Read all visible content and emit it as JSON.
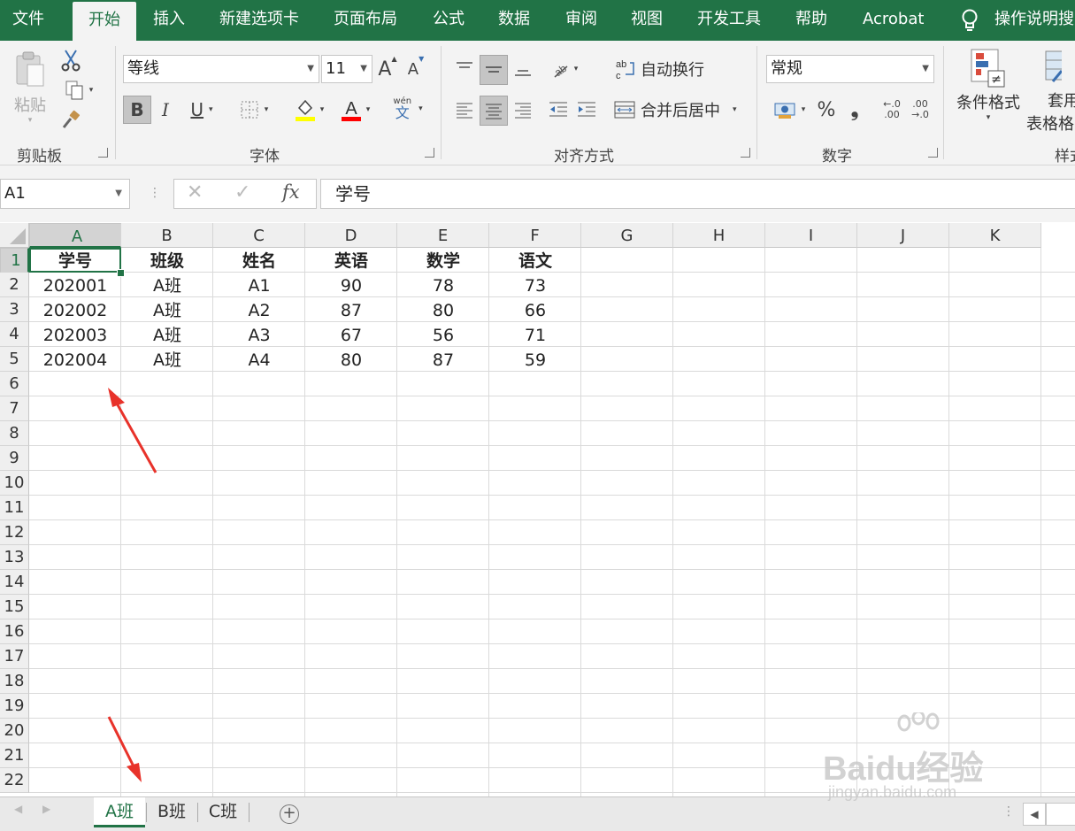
{
  "ribbon_tabs": [
    "文件",
    "开始",
    "插入",
    "新建选项卡",
    "页面布局",
    "公式",
    "数据",
    "审阅",
    "视图",
    "开发工具",
    "帮助",
    "Acrobat"
  ],
  "active_tab": "开始",
  "tell_me": "操作说明搜",
  "clipboard": {
    "paste_label": "粘贴",
    "group_label": "剪贴板"
  },
  "font": {
    "name": "等线",
    "size": "11",
    "grow": "A",
    "shrink": "A",
    "bold": "B",
    "italic": "I",
    "underline": "U",
    "phonetic_top": "wén",
    "phonetic_bottom": "文",
    "group_label": "字体",
    "fill_color": "#ffff00",
    "font_color": "#ff0000"
  },
  "alignment": {
    "wrap_label": "自动换行",
    "merge_label": "合并后居中",
    "group_label": "对齐方式"
  },
  "number": {
    "format": "常规",
    "percent": "%",
    "comma": "❟",
    "dec_inc_top": "←.0",
    "dec_inc_bottom": ".00",
    "dec_dec_top": ".00",
    "dec_dec_bottom": "→.0",
    "group_label": "数字"
  },
  "styles": {
    "cond_format": "条件格式",
    "table_format_1": "套用",
    "table_format_2": "表格格",
    "group_label": "样式"
  },
  "formula_bar": {
    "name_box": "A1",
    "fx": "fx",
    "content": "学号"
  },
  "columns": [
    "A",
    "B",
    "C",
    "D",
    "E",
    "F",
    "G",
    "H",
    "I",
    "J",
    "K"
  ],
  "rows": [
    "1",
    "2",
    "3",
    "4",
    "5",
    "6",
    "7",
    "8",
    "9",
    "10",
    "11",
    "12",
    "13",
    "14",
    "15",
    "16",
    "17",
    "18",
    "19",
    "20",
    "21",
    "22"
  ],
  "table": {
    "header": [
      "学号",
      "班级",
      "姓名",
      "英语",
      "数学",
      "语文"
    ],
    "rows": [
      [
        "202001",
        "A班",
        "A1",
        "90",
        "78",
        "73"
      ],
      [
        "202002",
        "A班",
        "A2",
        "87",
        "80",
        "66"
      ],
      [
        "202003",
        "A班",
        "A3",
        "67",
        "56",
        "71"
      ],
      [
        "202004",
        "A班",
        "A4",
        "80",
        "87",
        "59"
      ]
    ]
  },
  "sheets": [
    "A班",
    "B班",
    "C班"
  ],
  "active_sheet": "A班",
  "watermark": {
    "brand": "Baidu经验",
    "url": "jingyan.baidu.com"
  },
  "colors": {
    "accent": "#217346",
    "annotation_arrow": "#e8322a"
  }
}
